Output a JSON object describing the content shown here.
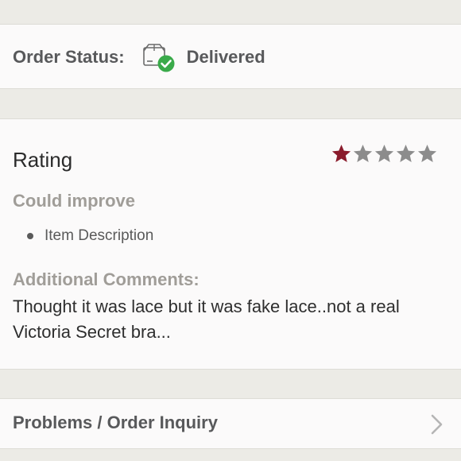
{
  "order_status": {
    "label": "Order Status:",
    "value": "Delivered",
    "icon": "package-delivered-icon"
  },
  "rating": {
    "title": "Rating",
    "stars_filled": 1,
    "stars_total": 5,
    "could_improve_heading": "Could improve",
    "could_improve_items": [
      "Item Description"
    ],
    "comments_heading": "Additional Comments:",
    "comments_text": "Thought it was lace but it was fake lace..not a real Victoria Secret bra..."
  },
  "inquiry": {
    "label": "Problems / Order Inquiry",
    "icon": "chevron-right-icon"
  },
  "colors": {
    "star_filled": "#8a1c2c",
    "star_empty": "#8c8c8c",
    "check_green": "#3aaa4a",
    "background": "#ecebe6",
    "card": "#fbfafa"
  }
}
